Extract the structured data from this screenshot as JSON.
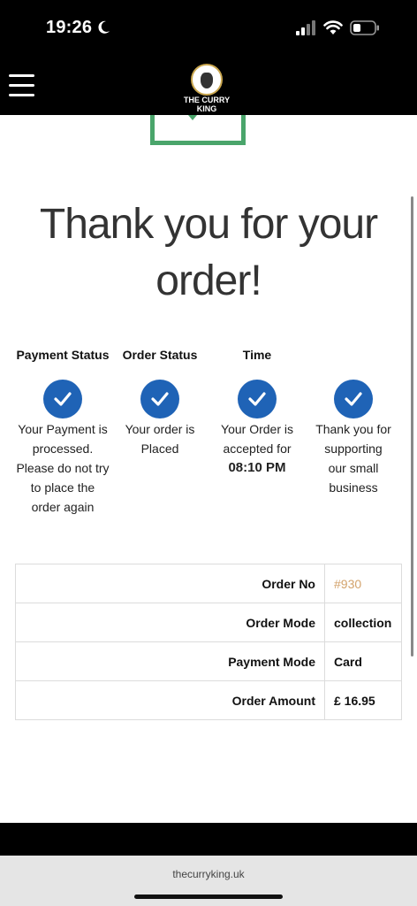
{
  "status_bar": {
    "time": "19:26",
    "icons": [
      "moon-icon",
      "cellular-signal-icon",
      "wifi-icon",
      "battery-icon"
    ]
  },
  "header": {
    "logo_text_line1": "THE CURRY",
    "logo_text_line2": "KING",
    "menu_icon": "hamburger-menu-icon"
  },
  "main": {
    "title_line1": "Thank you for your",
    "title_line2": "order!",
    "columns": [
      {
        "heading": "Payment Status",
        "lines": [
          "Your Payment is",
          "processed.",
          "Please do not try",
          "to place the",
          "order again"
        ]
      },
      {
        "heading": "Order Status",
        "lines": [
          "Your order is",
          "Placed"
        ]
      },
      {
        "heading": "Time",
        "lines": [
          "Your Order is",
          "accepted for"
        ],
        "emphasis": "08:10 PM"
      },
      {
        "heading": "",
        "lines": [
          "Thank you for",
          "supporting",
          "our small",
          "business"
        ]
      }
    ],
    "check_icon": "check-circle-icon"
  },
  "order_table": {
    "rows": [
      {
        "label": "Order No",
        "value": "#930"
      },
      {
        "label": "Order Mode",
        "value": "collection"
      },
      {
        "label": "Payment Mode",
        "value": "Card"
      },
      {
        "label": "Order Amount",
        "value": "£ 16.95"
      }
    ]
  },
  "browser": {
    "url": "thecurryking.uk"
  },
  "colors": {
    "accent_blue": "#1f63b6",
    "order_no_color": "#d3a36c",
    "green_border": "#4aa56b",
    "header_bg": "#000000"
  }
}
